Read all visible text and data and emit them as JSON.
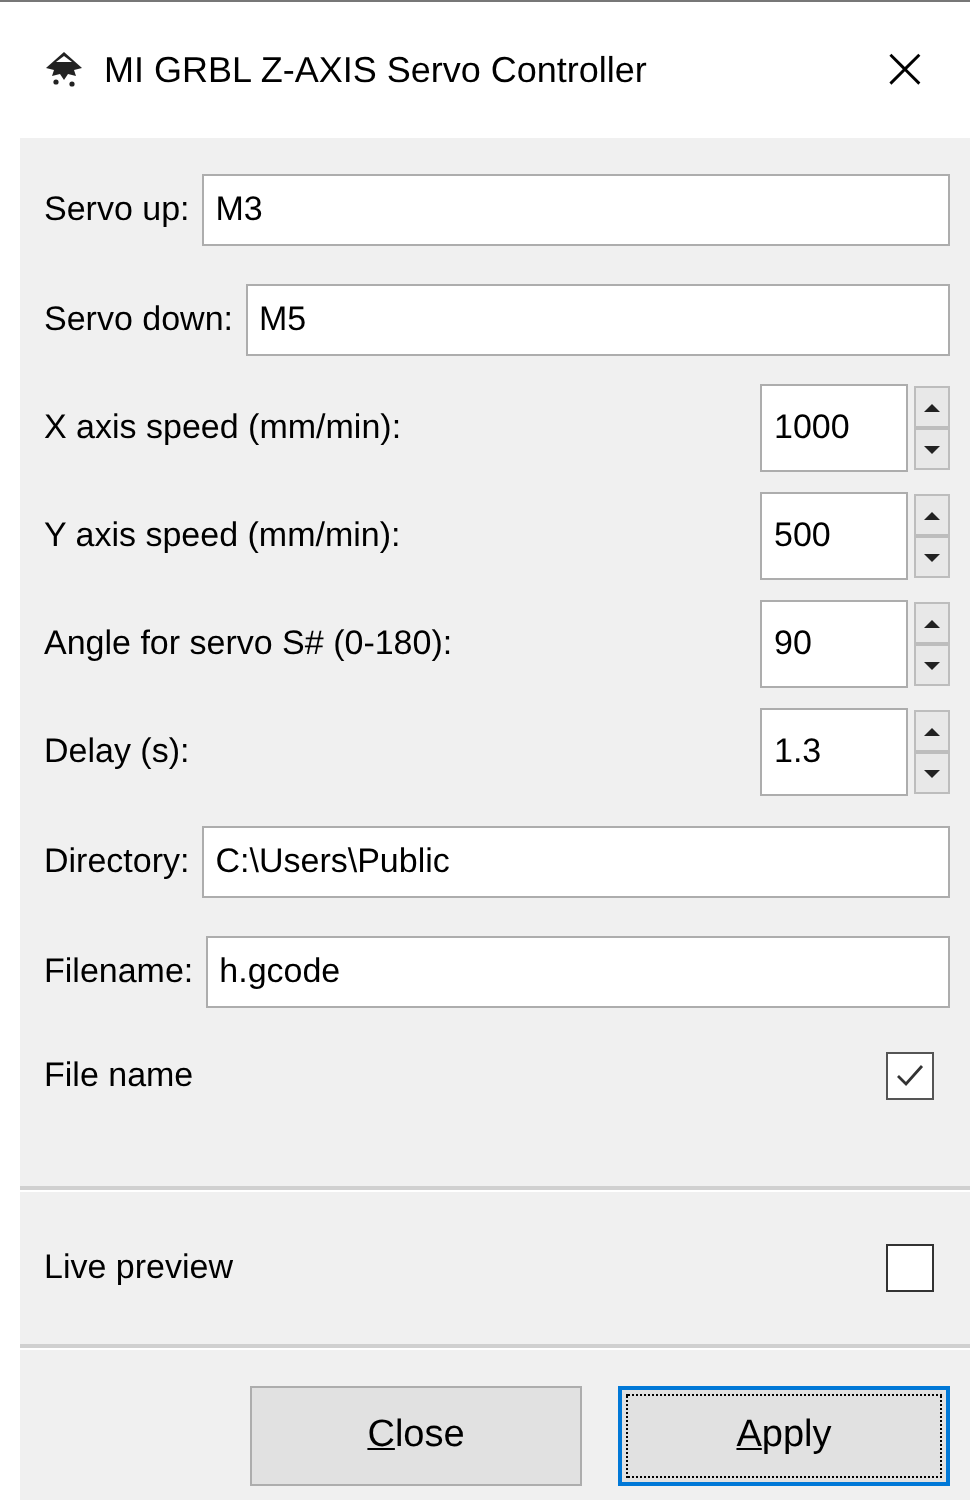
{
  "window": {
    "title": "MI GRBL Z-AXIS Servo Controller",
    "close": "×"
  },
  "fields": [
    {
      "kind": "text",
      "label": "Servo up:",
      "value": "M3"
    },
    {
      "kind": "text",
      "label": "Servo down:",
      "value": "M5"
    },
    {
      "kind": "spin",
      "label": "X axis speed (mm/min):",
      "value": "1000"
    },
    {
      "kind": "spin",
      "label": "Y axis speed (mm/min):",
      "value": "500"
    },
    {
      "kind": "spin",
      "label": "Angle for servo S# (0-180):",
      "value": "90"
    },
    {
      "kind": "spin",
      "label": "Delay (s):",
      "value": "1.3"
    },
    {
      "kind": "text",
      "label": "Directory:",
      "value": "C:\\Users\\Public"
    },
    {
      "kind": "text",
      "label": "Filename:",
      "value": "h.gcode"
    },
    {
      "kind": "check",
      "label": "File name",
      "checked": true
    }
  ],
  "live_preview": {
    "label": "Live preview",
    "checked": false
  },
  "buttons": [
    {
      "mnemonic": "C",
      "label_rest": "lose",
      "default": false
    },
    {
      "mnemonic": "A",
      "label_rest": "pply",
      "default": true
    }
  ]
}
